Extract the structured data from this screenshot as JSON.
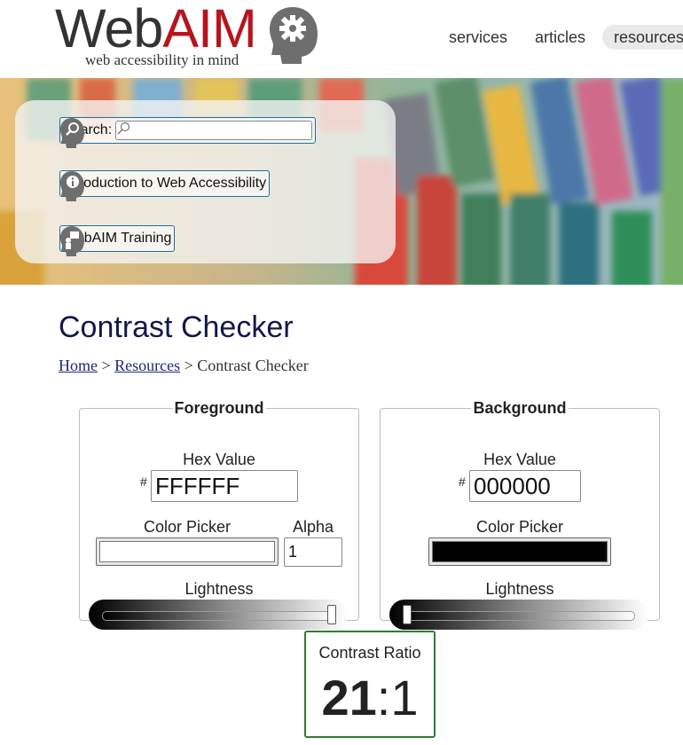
{
  "header": {
    "logo_web": "Web",
    "logo_aim": "AIM",
    "tagline": "web accessibility in mind",
    "nav": [
      "services",
      "articles",
      "resources"
    ]
  },
  "quick_links": {
    "search_label": "Search:",
    "search_value": "",
    "intro": "Introduction to Web Accessibility",
    "training": "WebAIM Training"
  },
  "page": {
    "title": "Contrast Checker",
    "breadcrumb": {
      "home": "Home",
      "sep": ">",
      "resources": "Resources",
      "current": "Contrast Checker"
    }
  },
  "foreground": {
    "legend": "Foreground",
    "hex_label": "Hex Value",
    "hash": "#",
    "hex_value": "FFFFFF",
    "picker_label": "Color Picker",
    "color": "#ffffff",
    "alpha_label": "Alpha",
    "alpha_value": "1",
    "lightness_label": "Lightness",
    "lightness": 1.0
  },
  "background": {
    "legend": "Background",
    "hex_label": "Hex Value",
    "hash": "#",
    "hex_value": "000000",
    "picker_label": "Color Picker",
    "color": "#000000",
    "lightness_label": "Lightness",
    "lightness": 0.0
  },
  "result": {
    "label": "Contrast Ratio",
    "ratio_left": "21",
    "ratio_right": ":1",
    "pass_color": "#2e7d32"
  },
  "colors": {
    "title": "#12184a",
    "link": "#1b2a7a",
    "logo_red": "#b8141d",
    "link_box_border": "#1f6f9f"
  }
}
